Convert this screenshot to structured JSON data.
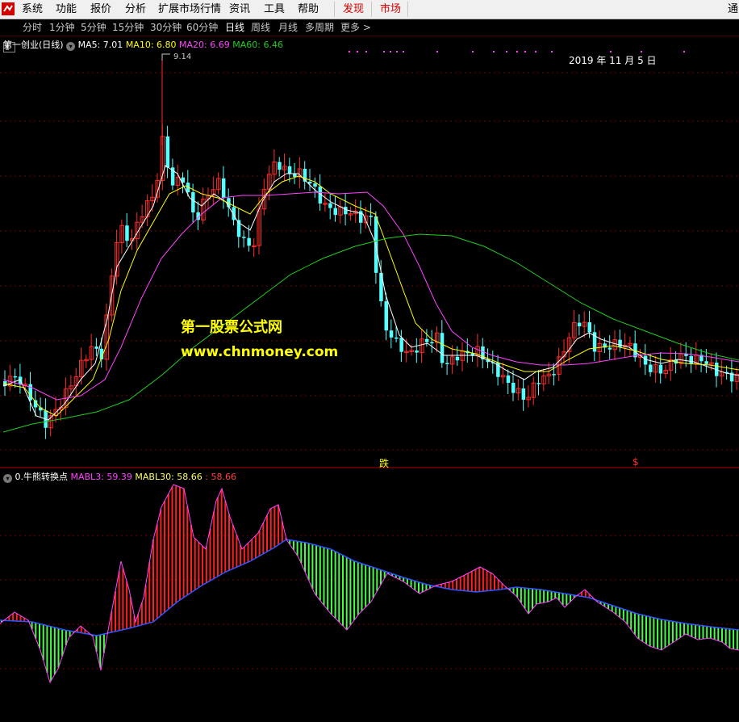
{
  "menu": {
    "items": [
      "系统",
      "功能",
      "报价",
      "分析",
      "扩展市场行情",
      "资讯",
      "工具",
      "帮助"
    ],
    "highlight": [
      "发现",
      "市场"
    ],
    "partial": "通"
  },
  "periods": {
    "items": [
      "分时",
      "1分钟",
      "5分钟",
      "15分钟",
      "30分钟",
      "60分钟",
      "日线",
      "周线",
      "月线",
      "多周期",
      "更多 >"
    ],
    "active": "日线"
  },
  "main_legend": {
    "title": "第一创业(日线)",
    "ma5": "MA5: 7.01",
    "ma10": "MA10: 6.80",
    "ma20": "MA20: 6.69",
    "ma60": "MA60: 6.46"
  },
  "sub_legend": {
    "title": "0.牛熊转换点",
    "mabl3": "MABL3: 59.39",
    "mabl30": "MABL30: 58.66",
    "extra": ": 58.66"
  },
  "annotations": {
    "high": "9.14",
    "date": "2019 年 11 月 5 日",
    "signal_fall": "跌",
    "signal_dollar": "$"
  },
  "watermark": {
    "line1": "第一股票公式网",
    "line2": "www.chnmoney.com"
  },
  "colors": {
    "up": "#ff2b2b",
    "down": "#54ffff",
    "ma5": "#ffffff",
    "ma10": "#ffff00",
    "ma20": "#ff44ff",
    "ma60": "#22cc22",
    "sub_up": "#ff2020",
    "sub_down": "#44ff44",
    "menu_highlight": "#d40000"
  }
}
